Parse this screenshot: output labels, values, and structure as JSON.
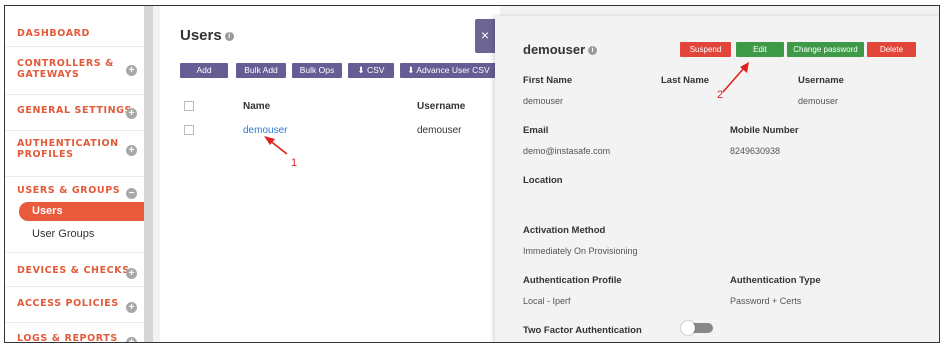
{
  "sidebar": {
    "sections": [
      {
        "label": "DASHBOARD",
        "toggle": ""
      },
      {
        "label": "CONTROLLERS &\nGATEWAYS",
        "toggle": "+"
      },
      {
        "label": "GENERAL SETTINGS",
        "toggle": "+"
      },
      {
        "label": "AUTHENTICATION\nPROFILES",
        "toggle": "+"
      },
      {
        "label": "USERS & GROUPS",
        "toggle": "−"
      },
      {
        "label": "DEVICES & CHECKS",
        "toggle": "+"
      },
      {
        "label": "ACCESS POLICIES",
        "toggle": "+"
      },
      {
        "label": "LOGS & REPORTS",
        "toggle": "+"
      }
    ],
    "sub_items": [
      "Users",
      "User Groups"
    ]
  },
  "main": {
    "title": "Users",
    "buttons": [
      "Add",
      "Bulk Add",
      "Bulk Ops",
      "CSV",
      "Advance User CSV"
    ],
    "columns": [
      "Name",
      "Username"
    ],
    "rows": [
      {
        "name": "demouser",
        "username": "demouser"
      }
    ]
  },
  "close_label": "×",
  "panel": {
    "title": "demouser",
    "actions": [
      "Suspend",
      "Edit",
      "Change password",
      "Delete"
    ],
    "fields": {
      "first_name": {
        "label": "First Name",
        "value": "demouser"
      },
      "last_name": {
        "label": "Last Name",
        "value": ""
      },
      "username": {
        "label": "Username",
        "value": "demouser"
      },
      "email": {
        "label": "Email",
        "value": "demo@instasafe.com"
      },
      "mobile": {
        "label": "Mobile Number",
        "value": "8249630938"
      },
      "location": {
        "label": "Location",
        "value": ""
      },
      "activation": {
        "label": "Activation Method",
        "value": "Immediately On Provisioning"
      },
      "auth_profile": {
        "label": "Authentication Profile",
        "value": "Local - Iperf"
      },
      "auth_type": {
        "label": "Authentication Type",
        "value": "Password + Certs"
      },
      "two_factor": {
        "label": "Two Factor Authentication",
        "enabled": false
      }
    }
  },
  "annotations": [
    "1",
    "2"
  ],
  "colors": {
    "accent": "#e95a3c",
    "primary_button": "#665d95",
    "edit": "#3e9a47",
    "danger": "#e2463a"
  }
}
